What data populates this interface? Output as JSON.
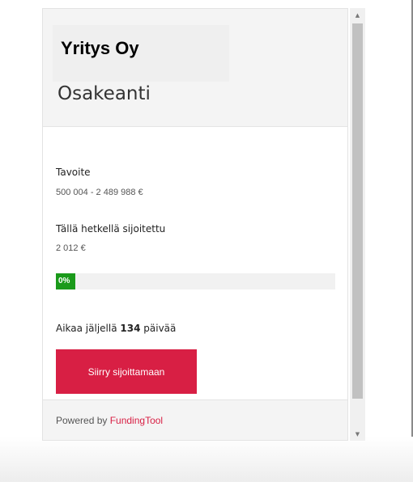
{
  "widget": {
    "company_name": "Yritys Oy",
    "offering_title": "Osakeanti",
    "target_label": "Tavoite",
    "target_value": "500 004 - 2 489 988 €",
    "invested_label": "Tällä hetkellä sijoitettu",
    "invested_value": "2 012 €",
    "progress": {
      "label": "0%",
      "percent": 0,
      "color": "#1a9a1a"
    },
    "time_left": {
      "prefix": "Aikaa jäljellä ",
      "days": "134",
      "suffix": " päivää"
    },
    "invest_button_label": "Siirry sijoittamaan",
    "accent_color": "#d81f44",
    "footer": {
      "powered_by": "Powered by ",
      "brand": "FundingTool"
    }
  },
  "scrollbar": {
    "up_icon": "scroll-up-arrow",
    "down_icon": "scroll-down-arrow"
  }
}
